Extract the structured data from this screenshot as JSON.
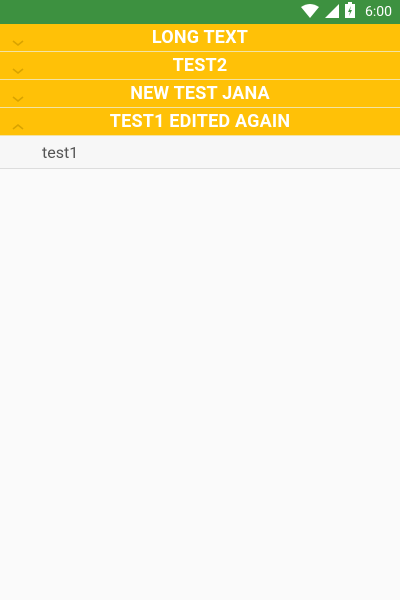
{
  "status_bar": {
    "time": "6:00",
    "icons": [
      "wifi-icon",
      "signal-icon",
      "battery-icon"
    ]
  },
  "groups": [
    {
      "title": "LONG TEXT",
      "expanded": false
    },
    {
      "title": "TEST2",
      "expanded": false
    },
    {
      "title": "NEW TEST JANA",
      "expanded": false
    },
    {
      "title": "TEST1 EDITED AGAIN",
      "expanded": true,
      "children": [
        {
          "label": "test1"
        }
      ]
    }
  ],
  "colors": {
    "status_bar": "#3d9140",
    "group_header": "#ffc107",
    "group_title": "#ffffff",
    "chevron": "#d9a300",
    "background": "#fafafa",
    "child_text": "#555555"
  }
}
